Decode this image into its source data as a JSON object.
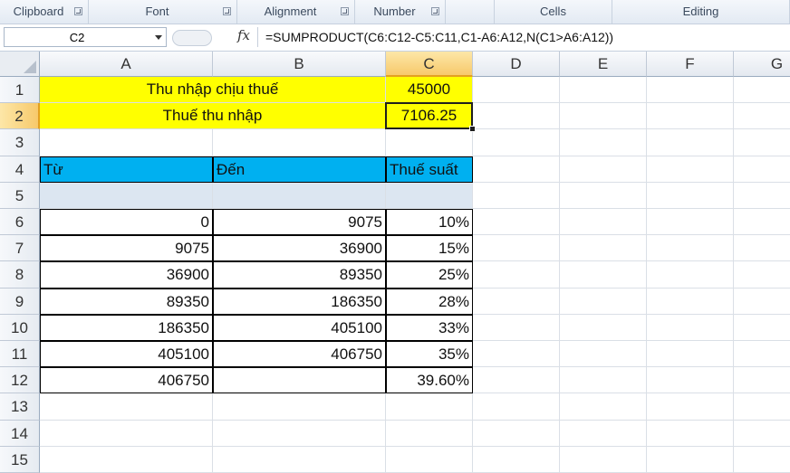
{
  "ribbon": {
    "groups": [
      {
        "label": "Clipboard",
        "launcher": true
      },
      {
        "label": "Font",
        "launcher": true
      },
      {
        "label": "Alignment",
        "launcher": true
      },
      {
        "label": "Number",
        "launcher": true
      },
      {
        "label": "",
        "launcher": false
      },
      {
        "label": "Cells",
        "launcher": false
      },
      {
        "label": "Editing",
        "launcher": false
      }
    ]
  },
  "formula_bar": {
    "name_box": "C2",
    "fx_icon": "fx",
    "formula": "=SUMPRODUCT(C6:C12-C5:C11,C1-A6:A12,N(C1>A6:A12))"
  },
  "sheet": {
    "columns": [
      "A",
      "B",
      "C",
      "D",
      "E",
      "F",
      "G"
    ],
    "rows": [
      "1",
      "2",
      "3",
      "4",
      "5",
      "6",
      "7",
      "8",
      "9",
      "10",
      "11",
      "12",
      "13",
      "14",
      "15"
    ],
    "selected_cell": "C2",
    "cells": {
      "A1": "Thu nhập chịu thuế",
      "C1": "45000",
      "A2": "Thuế thu nhập",
      "C2": "7106.25",
      "A4": "Từ",
      "B4": "Đến",
      "C4": "Thuế suất",
      "A6": "0",
      "B6": "9075",
      "C6": "10%",
      "A7": "9075",
      "B7": "36900",
      "C7": "15%",
      "A8": "36900",
      "B8": "89350",
      "C8": "25%",
      "A9": "89350",
      "B9": "186350",
      "C9": "28%",
      "A10": "186350",
      "B10": "405100",
      "C10": "33%",
      "A11": "405100",
      "B11": "406750",
      "C11": "35%",
      "A12": "406750",
      "B12": "",
      "C12": "39.60%"
    },
    "colors": {
      "yellow_fill": "#ffff00",
      "header_fill": "#00b0f0",
      "pale_fill": "#dce6f1"
    }
  }
}
